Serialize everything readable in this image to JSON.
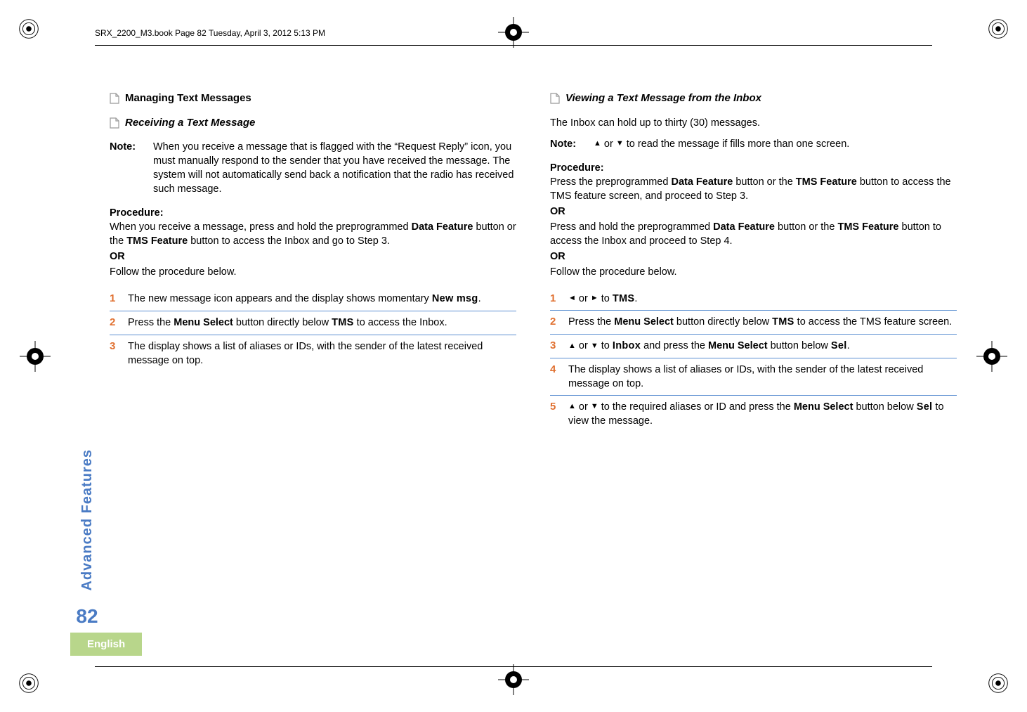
{
  "header": "SRX_2200_M3.book  Page 82  Tuesday, April 3, 2012  5:13 PM",
  "sidebar": {
    "label": "Advanced Features",
    "page_num": "82",
    "language": "English"
  },
  "left": {
    "section": "Managing Text Messages",
    "subsection": "Receiving a Text Message",
    "note_label": "Note:",
    "note_text": "When you receive a message that is flagged with the “Request Reply” icon, you must manually respond to the sender that you have received the message. The system will not automatically send back a notification that the radio has received such message.",
    "procedure_label": "Procedure:",
    "proc_line1a": "When you receive a message, press and hold the preprogrammed ",
    "proc_line1b": "Data Feature",
    "proc_line1c": " button or the ",
    "proc_line1d": "TMS Feature",
    "proc_line1e": " button to access the Inbox and go to Step 3.",
    "or": "OR",
    "proc_line2": "Follow the procedure below.",
    "steps": [
      {
        "n": "1",
        "a": "The new message icon appears and the display shows momentary ",
        "ui1": "New msg",
        "b": "."
      },
      {
        "n": "2",
        "a": "Press the ",
        "bold1": "Menu Select",
        "b": " button directly below ",
        "ui1": "TMS",
        "c": " to access the Inbox."
      },
      {
        "n": "3",
        "a": "The display shows a list of aliases or IDs, with the sender of the latest received message on top."
      }
    ]
  },
  "right": {
    "subsection": "Viewing a Text Message from the Inbox",
    "intro": "The Inbox can hold up to thirty (30) messages.",
    "note_label": "Note:",
    "note_a": " or ",
    "note_b": " to read the message if fills more than one screen.",
    "procedure_label": "Procedure:",
    "p1a": "Press the preprogrammed ",
    "p1b": "Data Feature",
    "p1c": " button or the ",
    "p1d": "TMS Feature",
    "p1e": " button to access the TMS feature screen, and proceed to Step 3.",
    "or": "OR",
    "p2a": "Press and hold the preprogrammed ",
    "p2b": "Data Feature",
    "p2c": " button or the ",
    "p2d": "TMS Feature",
    "p2e": " button to access the Inbox and proceed to Step 4.",
    "p3": "Follow the procedure below.",
    "steps": [
      {
        "n": "1",
        "a": " or ",
        "b": " to ",
        "ui1": "TMS",
        "c": "."
      },
      {
        "n": "2",
        "a": "Press the ",
        "bold1": "Menu Select",
        "b": " button directly below ",
        "ui1": "TMS",
        "c": " to access the TMS feature screen."
      },
      {
        "n": "3",
        "a": " or ",
        "b": " to ",
        "ui1": "Inbox",
        "c": " and press the ",
        "bold1": "Menu Select",
        "d": " button below ",
        "ui2": "Sel",
        "e": "."
      },
      {
        "n": "4",
        "a": "The display shows a list of aliases or IDs, with the sender of the latest received message on top."
      },
      {
        "n": "5",
        "a": " or ",
        "b": " to the required aliases or ID and press the ",
        "bold1": "Menu Select",
        "c": " button below ",
        "ui1": "Sel",
        "d": " to view the message."
      }
    ]
  }
}
